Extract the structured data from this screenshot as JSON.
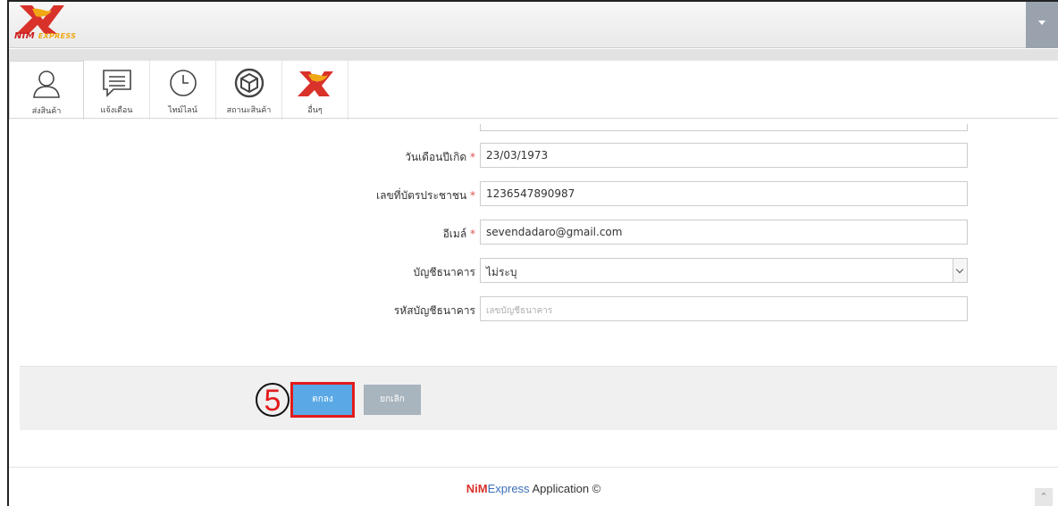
{
  "brand": {
    "name": "NIM",
    "suffix": "EXPRESS"
  },
  "nav": [
    {
      "label": "ส่งสินค้า",
      "icon": "user-icon"
    },
    {
      "label": "แจ้งเตือน",
      "icon": "message-icon"
    },
    {
      "label": "ไทม์ไลน์",
      "icon": "clock-icon"
    },
    {
      "label": "สถานะสินค้า",
      "icon": "package-status-icon"
    },
    {
      "label": "อื่นๆ",
      "icon": "nim-logo-icon"
    }
  ],
  "form": {
    "birthdate": {
      "label": "วันเดือนปีเกิด",
      "required": "*",
      "value": "23/03/1973"
    },
    "id_card": {
      "label": "เลขที่บัตรประชาชน",
      "required": "*",
      "value": "1236547890987"
    },
    "email": {
      "label": "อีเมล์",
      "required": "*",
      "value": "sevendadaro@gmail.com"
    },
    "bank": {
      "label": "บัญชีธนาคาร",
      "value": "ไม่ระบุ"
    },
    "bank_account": {
      "label": "รหัสบัญชีธนาคาร",
      "placeholder": "เลขบัญชีธนาคาร"
    }
  },
  "buttons": {
    "ok": "ตกลง",
    "cancel": "ยกเลิก"
  },
  "annotation": {
    "step": "5"
  },
  "footer": {
    "nim": "NiM",
    "express": "Express",
    "rest": " Application ©"
  },
  "colors": {
    "primary": "#5aa9e6",
    "highlight": "#e21b1b",
    "brand_red": "#d9322b",
    "brand_blue": "#3b6fb6"
  }
}
